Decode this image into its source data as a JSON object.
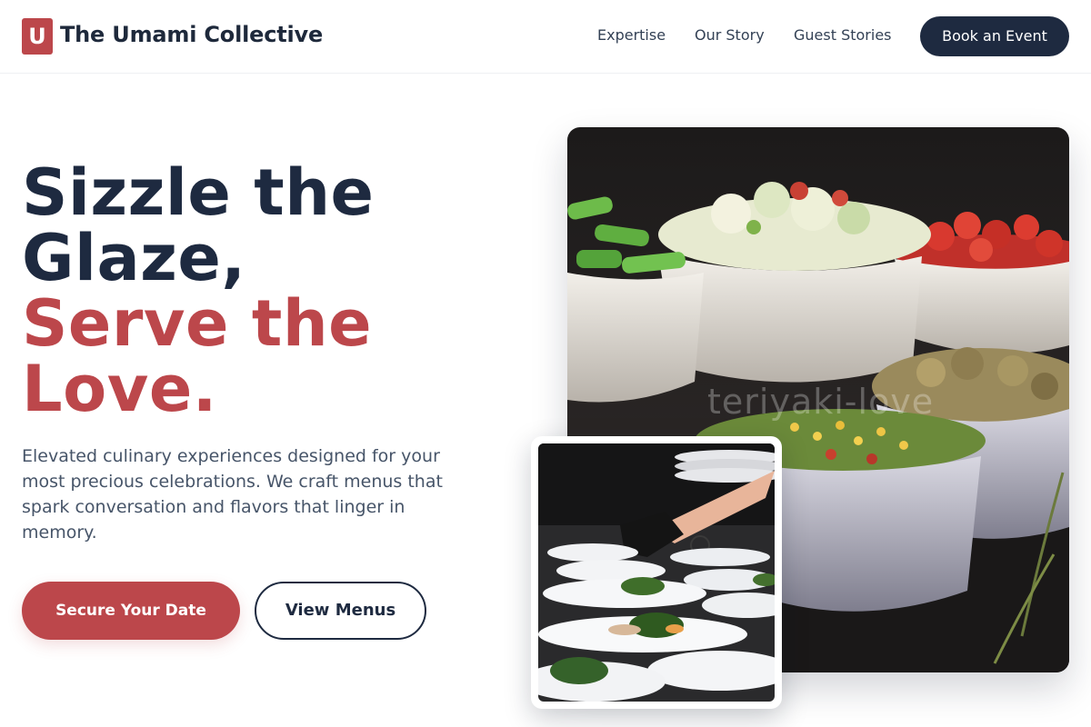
{
  "header": {
    "logo_letter": "U",
    "brand": "The Umami Collective",
    "nav": [
      "Expertise",
      "Our Story",
      "Guest Stories"
    ],
    "cta": "Book an Event"
  },
  "hero": {
    "headline_dark": [
      "Sizzle the",
      "Glaze,"
    ],
    "headline_accent": [
      "Serve the",
      "Love."
    ],
    "lede": "Elevated culinary experiences designed for your most precious celebrations. We craft menus that spark conversation and flavors that linger in memory.",
    "primary_cta": "Secure Your Date",
    "secondary_cta": "View Menus"
  },
  "images": {
    "main_watermark": "teriyaki-love"
  },
  "colors": {
    "accent": "#bc474b",
    "navy": "#1e2a40"
  }
}
